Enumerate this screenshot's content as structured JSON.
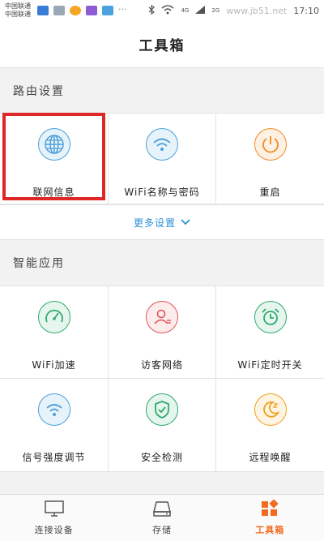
{
  "statusbar": {
    "carrier1": "中国联通",
    "carrier2": "中国联通",
    "network": "4G",
    "network2": "2G",
    "time": "17:10",
    "watermark": "www.jb51.net"
  },
  "header": {
    "title": "工具箱"
  },
  "router_section": {
    "title": "路由设置",
    "items": [
      {
        "label": "联网信息",
        "icon": "globe-icon",
        "color": "#4b9fd8"
      },
      {
        "label": "WiFi名称与密码",
        "icon": "wifi-icon",
        "color": "#4b9fd8"
      },
      {
        "label": "重启",
        "icon": "power-icon",
        "color": "#f08a24"
      }
    ],
    "more_label": "更多设置"
  },
  "smart_section": {
    "title": "智能应用",
    "items": [
      {
        "label": "WiFi加速",
        "icon": "speedometer-icon",
        "color": "#2eaa6b"
      },
      {
        "label": "访客网络",
        "icon": "guest-icon",
        "color": "#e0525a"
      },
      {
        "label": "WiFi定时开关",
        "icon": "alarm-clock-icon",
        "color": "#2eaa6b"
      },
      {
        "label": "信号强度调节",
        "icon": "signal-strength-icon",
        "color": "#4b9fd8"
      },
      {
        "label": "安全检测",
        "icon": "shield-icon",
        "color": "#2eaa6b"
      },
      {
        "label": "远程唤醒",
        "icon": "moon-icon",
        "color": "#f0a020"
      }
    ]
  },
  "tabbar": {
    "tabs": [
      {
        "label": "连接设备",
        "icon": "monitor-icon"
      },
      {
        "label": "存储",
        "icon": "storage-icon"
      },
      {
        "label": "工具箱",
        "icon": "toolbox-icon",
        "active": true
      }
    ],
    "accent": "#f26b21"
  }
}
